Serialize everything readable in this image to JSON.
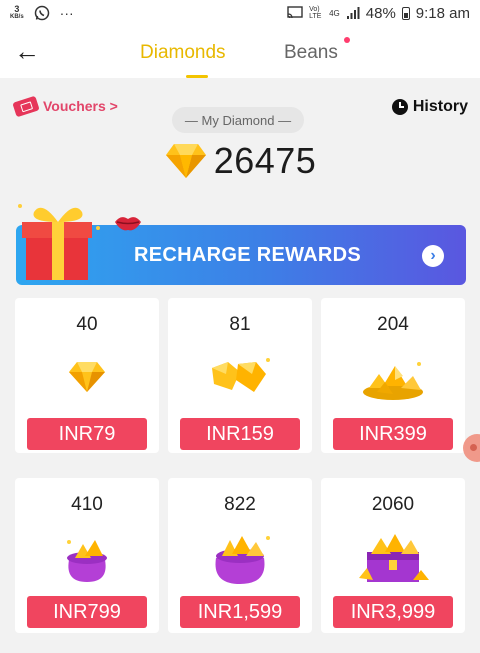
{
  "status_bar": {
    "speed_value": "3",
    "speed_unit": "KB/s",
    "whatsapp_icon": "whatsapp-icon",
    "more_dots": "···",
    "network": "Vo) LTE",
    "network_type": "4G",
    "battery": "48%",
    "time": "9:18 am"
  },
  "header": {
    "tabs": [
      {
        "label": "Diamonds",
        "active": true
      },
      {
        "label": "Beans",
        "active": false,
        "has_dot": true
      }
    ]
  },
  "vouchers_label": "Vouchers >",
  "history_label": "History",
  "my_diamond_label": "— My Diamond —",
  "balance": "26475",
  "banner": {
    "title": "RECHARGE REWARDS",
    "arrow": "›"
  },
  "packages": [
    {
      "amount": "40",
      "price": "INR79",
      "icon": "single-diamond-icon"
    },
    {
      "amount": "81",
      "price": "INR159",
      "icon": "two-diamonds-icon"
    },
    {
      "amount": "204",
      "price": "INR399",
      "icon": "diamond-pile-icon"
    },
    {
      "amount": "410",
      "price": "INR799",
      "icon": "purple-bag-icon"
    },
    {
      "amount": "822",
      "price": "INR1,599",
      "icon": "purple-bag-large-icon"
    },
    {
      "amount": "2060",
      "price": "INR3,999",
      "icon": "treasure-chest-icon"
    }
  ],
  "colors": {
    "accent_yellow": "#e8b800",
    "price_red": "#f0455f",
    "banner_blue": "#3d7fe6",
    "voucher_pink": "#e2466a"
  }
}
